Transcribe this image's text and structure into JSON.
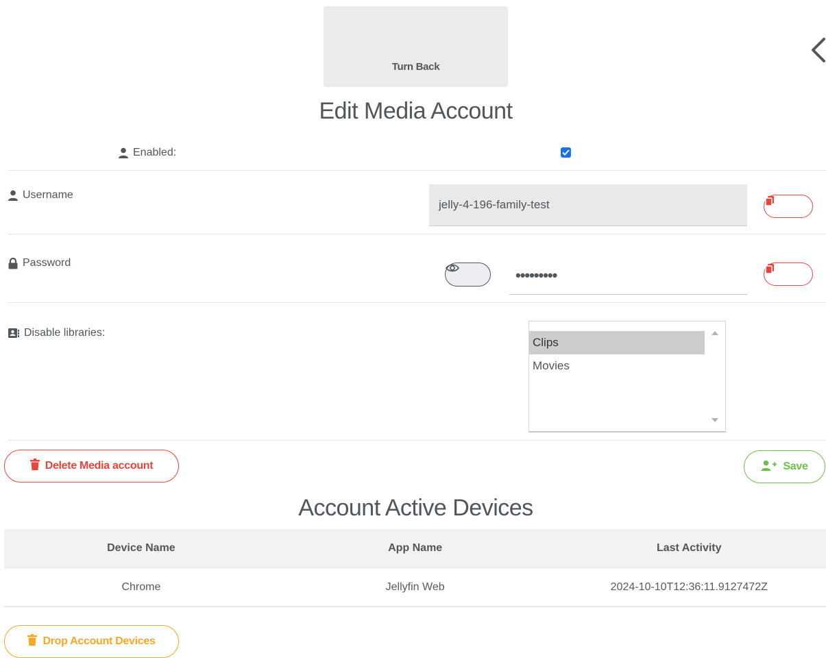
{
  "nav": {
    "turn_back_label": "Turn Back"
  },
  "page_title": "Edit Media Account",
  "form": {
    "enabled_label": "Enabled:",
    "enabled_checked": true,
    "username_label": "Username",
    "username_value": "jelly-4-196-family-test",
    "password_label": "Password",
    "password_masked": "•••••••••",
    "libraries_label": "Disable libraries:",
    "libraries_options": [
      "Clips",
      "Movies"
    ],
    "libraries_selected": "Clips"
  },
  "actions": {
    "delete_label": "Delete Media account",
    "save_label": "Save",
    "drop_devices_label": "Drop Account Devices"
  },
  "devices": {
    "title": "Account Active Devices",
    "columns": [
      "Device Name",
      "App Name",
      "Last Activity"
    ],
    "rows": [
      [
        "Chrome",
        "Jellyfin Web",
        "2024-10-10T12:36:11.9127472Z"
      ]
    ]
  },
  "colors": {
    "danger": "#e8453c",
    "success": "#6cc04a",
    "warning": "#f7a823",
    "checkbox": "#1a73e8",
    "text": "#4f565c"
  },
  "icons": [
    "chevron-left-icon",
    "user-icon",
    "lock-icon",
    "address-book-icon",
    "copy-icon",
    "eye-icon",
    "trash-icon",
    "user-plus-icon"
  ]
}
